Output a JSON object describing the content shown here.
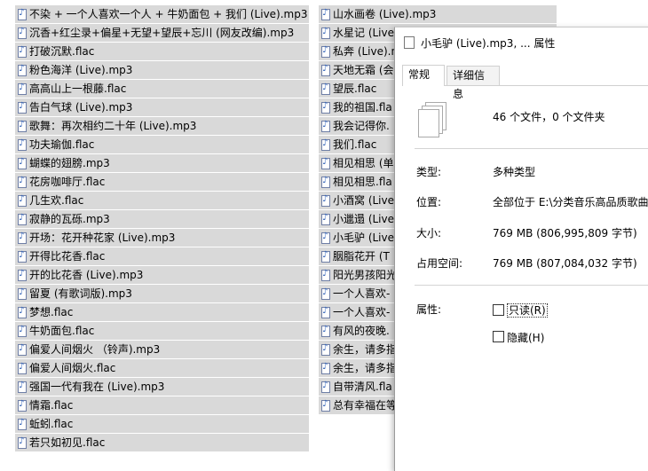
{
  "files_left": [
    "不染 + 一个人喜欢一个人 + 牛奶面包 + 我们 (Live).mp3",
    "沉香+红尘录+偏星+无望+望辰+忘川 (网友改编).mp3",
    "打破沉默.flac",
    "粉色海洋 (Live).mp3",
    "高高山上一根藤.flac",
    "告白气球 (Live).mp3",
    "歌舞：再次相约二十年 (Live).mp3",
    "功夫瑜伽.flac",
    "蝴蝶的翅膀.mp3",
    "花房咖啡厅.flac",
    "几生欢.flac",
    "寂静的瓦砾.mp3",
    "开场：花开种花家 (Live).mp3",
    "开得比花香.flac",
    "开的比花香 (Live).mp3",
    "留夏 (有歌词版).mp3",
    "梦想.flac",
    "牛奶面包.flac",
    "偏爱人间烟火 （铃声).mp3",
    "偏爱人间烟火.flac",
    "强国一代有我在 (Live).mp3",
    "情霜.flac",
    "蚯蚓.flac",
    "若只如初见.flac"
  ],
  "files_right": [
    "山水画卷 (Live).mp3",
    "水星记 (Live",
    "私奔 (Live).n",
    "天地无霜 (会",
    "望辰.flac",
    "我的祖国.fla",
    "我会记得你.",
    "我们.flac",
    "相见相思 (单",
    "相见相思.fla",
    "小酒窝 (Live",
    "小邋遢 (Live",
    "小毛驴 (Live",
    "胭脂花开 (T",
    "阳光男孩阳光",
    "一个人喜欢-",
    "一个人喜欢-",
    "有风的夜晚.",
    "余生，请多指",
    "余生，请多指",
    "自带清风.fla",
    "总有幸福在等"
  ],
  "dialog": {
    "title": "小毛驴 (Live).mp3, ... 属性",
    "tabs": [
      "常规",
      "详细信息"
    ],
    "summary": "46 个文件，0 个文件夹",
    "type_label": "类型:",
    "type_value": "多种类型",
    "location_label": "位置:",
    "location_value": "全部位于 E:\\分类音乐高品质歌曲",
    "size_label": "大小:",
    "size_value": "769 MB (806,995,809 字节)",
    "disk_label": "占用空间:",
    "disk_value": "769 MB (807,084,032 字节)",
    "attr_label": "属性:",
    "readonly_label": "只读(R)",
    "hidden_label": "隐藏(H)"
  }
}
